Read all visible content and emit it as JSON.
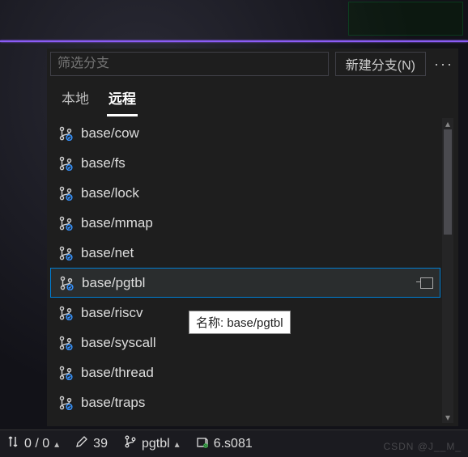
{
  "header": {
    "filter_placeholder": "筛选分支",
    "new_branch_label": "新建分支(N)",
    "more_label": "···"
  },
  "tabs": {
    "local": "本地",
    "remote": "远程",
    "active": "remote"
  },
  "branches": {
    "items": [
      {
        "label": "base/cow"
      },
      {
        "label": "base/fs"
      },
      {
        "label": "base/lock"
      },
      {
        "label": "base/mmap"
      },
      {
        "label": "base/net"
      },
      {
        "label": "base/pgtbl"
      },
      {
        "label": "base/riscv"
      },
      {
        "label": "base/syscall"
      },
      {
        "label": "base/thread"
      },
      {
        "label": "base/traps"
      }
    ],
    "selected_index": 5
  },
  "tooltip": {
    "text": "名称: base/pgtbl"
  },
  "statusbar": {
    "sync": "0 / 0",
    "changes": "39",
    "branch": "pgtbl",
    "repo": "6.s081"
  },
  "watermark": "CSDN @J__M_"
}
